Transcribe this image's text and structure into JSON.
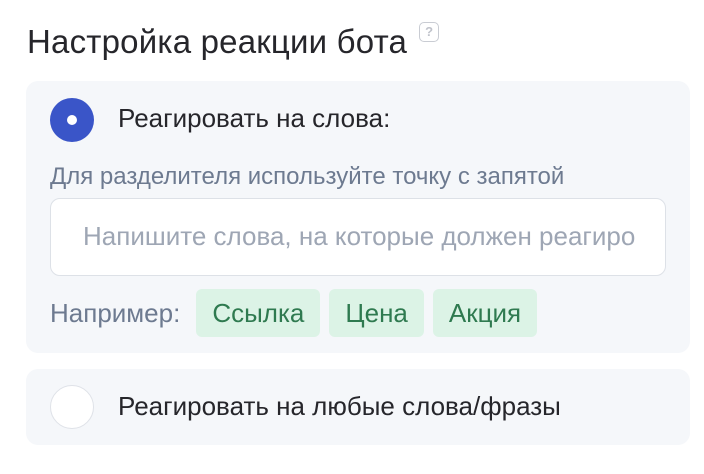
{
  "title": "Настройка реакции бота",
  "help_icon_glyph": "?",
  "option_keywords": {
    "label": "Реагировать на слова:",
    "selected": true,
    "hint": "Для разделителя используйте точку с запятой",
    "input_placeholder": "Напишите слова, на которые должен реагировать бот",
    "input_value": "",
    "examples_label": "Например:",
    "examples": [
      "Ссылка",
      "Цена",
      "Акция"
    ]
  },
  "option_any": {
    "label": "Реагировать на любые слова/фразы",
    "selected": false
  },
  "colors": {
    "accent": "#3a55c8",
    "chip_bg": "#dcf3e6",
    "chip_text": "#2f7a50",
    "card_bg": "#f5f7fa"
  }
}
